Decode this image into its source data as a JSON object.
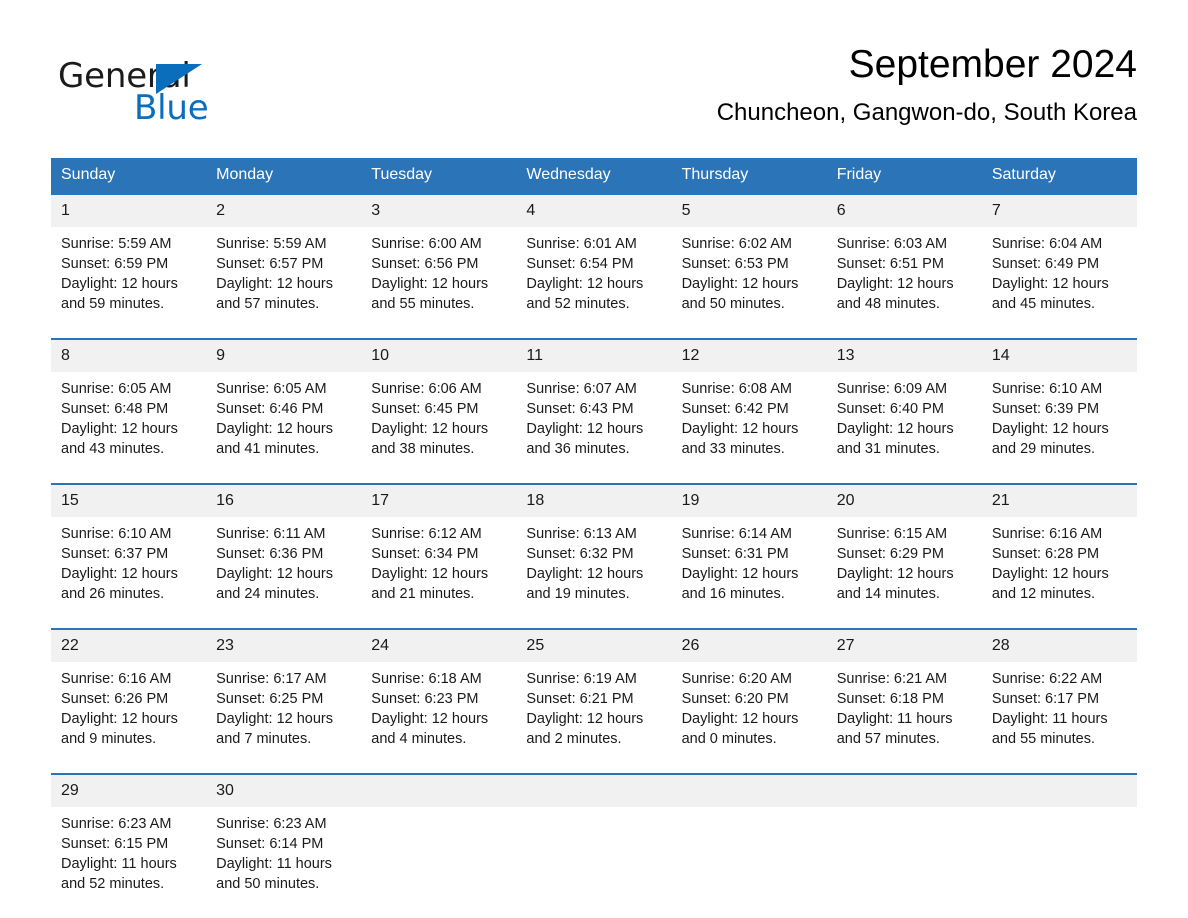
{
  "logo": {
    "word_dark": "General",
    "word_blue": "Blue",
    "triangle_color": "#0a6ebd"
  },
  "header": {
    "title": "September 2024",
    "subtitle": "Chuncheon, Gangwon-do, South Korea"
  },
  "theme": {
    "header_blue": "#2b74b8",
    "daynum_band": "#f1f1f1",
    "text": "#1a1a1a",
    "page_bg": "#ffffff"
  },
  "calendar": {
    "weekday_headers": [
      "Sunday",
      "Monday",
      "Tuesday",
      "Wednesday",
      "Thursday",
      "Friday",
      "Saturday"
    ],
    "weeks": [
      [
        {
          "day": "1",
          "sunrise": "Sunrise: 5:59 AM",
          "sunset": "Sunset: 6:59 PM",
          "daylight_line1": "Daylight: 12 hours",
          "daylight_line2": "and 59 minutes."
        },
        {
          "day": "2",
          "sunrise": "Sunrise: 5:59 AM",
          "sunset": "Sunset: 6:57 PM",
          "daylight_line1": "Daylight: 12 hours",
          "daylight_line2": "and 57 minutes."
        },
        {
          "day": "3",
          "sunrise": "Sunrise: 6:00 AM",
          "sunset": "Sunset: 6:56 PM",
          "daylight_line1": "Daylight: 12 hours",
          "daylight_line2": "and 55 minutes."
        },
        {
          "day": "4",
          "sunrise": "Sunrise: 6:01 AM",
          "sunset": "Sunset: 6:54 PM",
          "daylight_line1": "Daylight: 12 hours",
          "daylight_line2": "and 52 minutes."
        },
        {
          "day": "5",
          "sunrise": "Sunrise: 6:02 AM",
          "sunset": "Sunset: 6:53 PM",
          "daylight_line1": "Daylight: 12 hours",
          "daylight_line2": "and 50 minutes."
        },
        {
          "day": "6",
          "sunrise": "Sunrise: 6:03 AM",
          "sunset": "Sunset: 6:51 PM",
          "daylight_line1": "Daylight: 12 hours",
          "daylight_line2": "and 48 minutes."
        },
        {
          "day": "7",
          "sunrise": "Sunrise: 6:04 AM",
          "sunset": "Sunset: 6:49 PM",
          "daylight_line1": "Daylight: 12 hours",
          "daylight_line2": "and 45 minutes."
        }
      ],
      [
        {
          "day": "8",
          "sunrise": "Sunrise: 6:05 AM",
          "sunset": "Sunset: 6:48 PM",
          "daylight_line1": "Daylight: 12 hours",
          "daylight_line2": "and 43 minutes."
        },
        {
          "day": "9",
          "sunrise": "Sunrise: 6:05 AM",
          "sunset": "Sunset: 6:46 PM",
          "daylight_line1": "Daylight: 12 hours",
          "daylight_line2": "and 41 minutes."
        },
        {
          "day": "10",
          "sunrise": "Sunrise: 6:06 AM",
          "sunset": "Sunset: 6:45 PM",
          "daylight_line1": "Daylight: 12 hours",
          "daylight_line2": "and 38 minutes."
        },
        {
          "day": "11",
          "sunrise": "Sunrise: 6:07 AM",
          "sunset": "Sunset: 6:43 PM",
          "daylight_line1": "Daylight: 12 hours",
          "daylight_line2": "and 36 minutes."
        },
        {
          "day": "12",
          "sunrise": "Sunrise: 6:08 AM",
          "sunset": "Sunset: 6:42 PM",
          "daylight_line1": "Daylight: 12 hours",
          "daylight_line2": "and 33 minutes."
        },
        {
          "day": "13",
          "sunrise": "Sunrise: 6:09 AM",
          "sunset": "Sunset: 6:40 PM",
          "daylight_line1": "Daylight: 12 hours",
          "daylight_line2": "and 31 minutes."
        },
        {
          "day": "14",
          "sunrise": "Sunrise: 6:10 AM",
          "sunset": "Sunset: 6:39 PM",
          "daylight_line1": "Daylight: 12 hours",
          "daylight_line2": "and 29 minutes."
        }
      ],
      [
        {
          "day": "15",
          "sunrise": "Sunrise: 6:10 AM",
          "sunset": "Sunset: 6:37 PM",
          "daylight_line1": "Daylight: 12 hours",
          "daylight_line2": "and 26 minutes."
        },
        {
          "day": "16",
          "sunrise": "Sunrise: 6:11 AM",
          "sunset": "Sunset: 6:36 PM",
          "daylight_line1": "Daylight: 12 hours",
          "daylight_line2": "and 24 minutes."
        },
        {
          "day": "17",
          "sunrise": "Sunrise: 6:12 AM",
          "sunset": "Sunset: 6:34 PM",
          "daylight_line1": "Daylight: 12 hours",
          "daylight_line2": "and 21 minutes."
        },
        {
          "day": "18",
          "sunrise": "Sunrise: 6:13 AM",
          "sunset": "Sunset: 6:32 PM",
          "daylight_line1": "Daylight: 12 hours",
          "daylight_line2": "and 19 minutes."
        },
        {
          "day": "19",
          "sunrise": "Sunrise: 6:14 AM",
          "sunset": "Sunset: 6:31 PM",
          "daylight_line1": "Daylight: 12 hours",
          "daylight_line2": "and 16 minutes."
        },
        {
          "day": "20",
          "sunrise": "Sunrise: 6:15 AM",
          "sunset": "Sunset: 6:29 PM",
          "daylight_line1": "Daylight: 12 hours",
          "daylight_line2": "and 14 minutes."
        },
        {
          "day": "21",
          "sunrise": "Sunrise: 6:16 AM",
          "sunset": "Sunset: 6:28 PM",
          "daylight_line1": "Daylight: 12 hours",
          "daylight_line2": "and 12 minutes."
        }
      ],
      [
        {
          "day": "22",
          "sunrise": "Sunrise: 6:16 AM",
          "sunset": "Sunset: 6:26 PM",
          "daylight_line1": "Daylight: 12 hours",
          "daylight_line2": "and 9 minutes."
        },
        {
          "day": "23",
          "sunrise": "Sunrise: 6:17 AM",
          "sunset": "Sunset: 6:25 PM",
          "daylight_line1": "Daylight: 12 hours",
          "daylight_line2": "and 7 minutes."
        },
        {
          "day": "24",
          "sunrise": "Sunrise: 6:18 AM",
          "sunset": "Sunset: 6:23 PM",
          "daylight_line1": "Daylight: 12 hours",
          "daylight_line2": "and 4 minutes."
        },
        {
          "day": "25",
          "sunrise": "Sunrise: 6:19 AM",
          "sunset": "Sunset: 6:21 PM",
          "daylight_line1": "Daylight: 12 hours",
          "daylight_line2": "and 2 minutes."
        },
        {
          "day": "26",
          "sunrise": "Sunrise: 6:20 AM",
          "sunset": "Sunset: 6:20 PM",
          "daylight_line1": "Daylight: 12 hours",
          "daylight_line2": "and 0 minutes."
        },
        {
          "day": "27",
          "sunrise": "Sunrise: 6:21 AM",
          "sunset": "Sunset: 6:18 PM",
          "daylight_line1": "Daylight: 11 hours",
          "daylight_line2": "and 57 minutes."
        },
        {
          "day": "28",
          "sunrise": "Sunrise: 6:22 AM",
          "sunset": "Sunset: 6:17 PM",
          "daylight_line1": "Daylight: 11 hours",
          "daylight_line2": "and 55 minutes."
        }
      ],
      [
        {
          "day": "29",
          "sunrise": "Sunrise: 6:23 AM",
          "sunset": "Sunset: 6:15 PM",
          "daylight_line1": "Daylight: 11 hours",
          "daylight_line2": "and 52 minutes."
        },
        {
          "day": "30",
          "sunrise": "Sunrise: 6:23 AM",
          "sunset": "Sunset: 6:14 PM",
          "daylight_line1": "Daylight: 11 hours",
          "daylight_line2": "and 50 minutes."
        },
        {
          "day": "",
          "sunrise": "",
          "sunset": "",
          "daylight_line1": "",
          "daylight_line2": ""
        },
        {
          "day": "",
          "sunrise": "",
          "sunset": "",
          "daylight_line1": "",
          "daylight_line2": ""
        },
        {
          "day": "",
          "sunrise": "",
          "sunset": "",
          "daylight_line1": "",
          "daylight_line2": ""
        },
        {
          "day": "",
          "sunrise": "",
          "sunset": "",
          "daylight_line1": "",
          "daylight_line2": ""
        },
        {
          "day": "",
          "sunrise": "",
          "sunset": "",
          "daylight_line1": "",
          "daylight_line2": ""
        }
      ]
    ]
  }
}
